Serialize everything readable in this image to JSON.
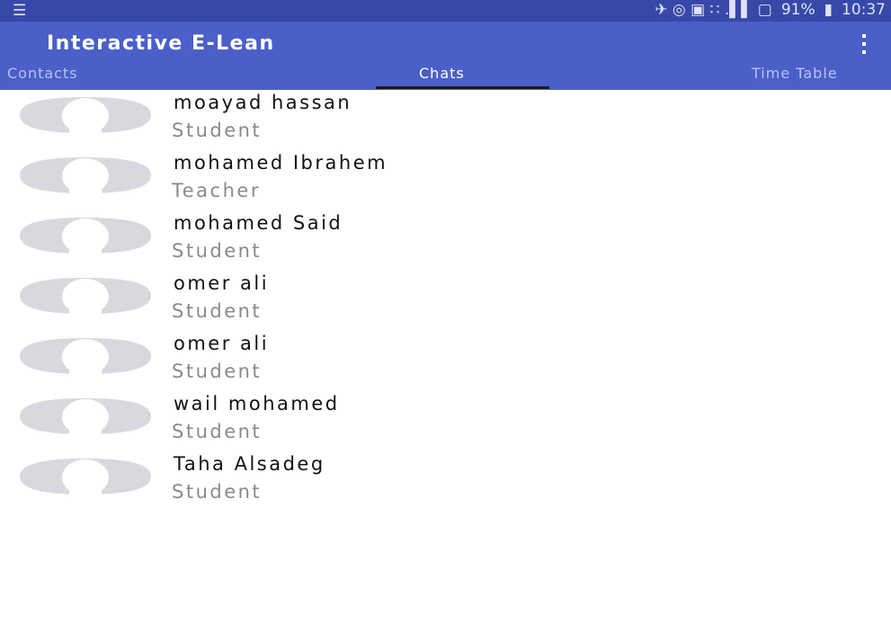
{
  "status_bar": {
    "left_icon": "notification-list-icon",
    "icons_text": "✈ ◎ ▣ ∷ .▌▌ ▢",
    "battery_pct": "91%",
    "time": "10:37"
  },
  "app_bar": {
    "title": "Interactive E-Lean",
    "menu_icon": "overflow-menu-icon",
    "color": "#4b5fc9"
  },
  "tabs": [
    {
      "label": "Contacts"
    },
    {
      "label": "Chats"
    },
    {
      "label": "Time Table"
    }
  ],
  "chats": [
    {
      "name": "moayad hassan",
      "role": "Student"
    },
    {
      "name": "mohamed Ibrahem",
      "role": "Teacher"
    },
    {
      "name": "mohamed Said",
      "role": "Student"
    },
    {
      "name": "omer ali",
      "role": "Student"
    },
    {
      "name": "omer ali",
      "role": "Student"
    },
    {
      "name": "wail mohamed",
      "role": "Student"
    },
    {
      "name": "Taha Alsadeg",
      "role": "Student"
    }
  ]
}
